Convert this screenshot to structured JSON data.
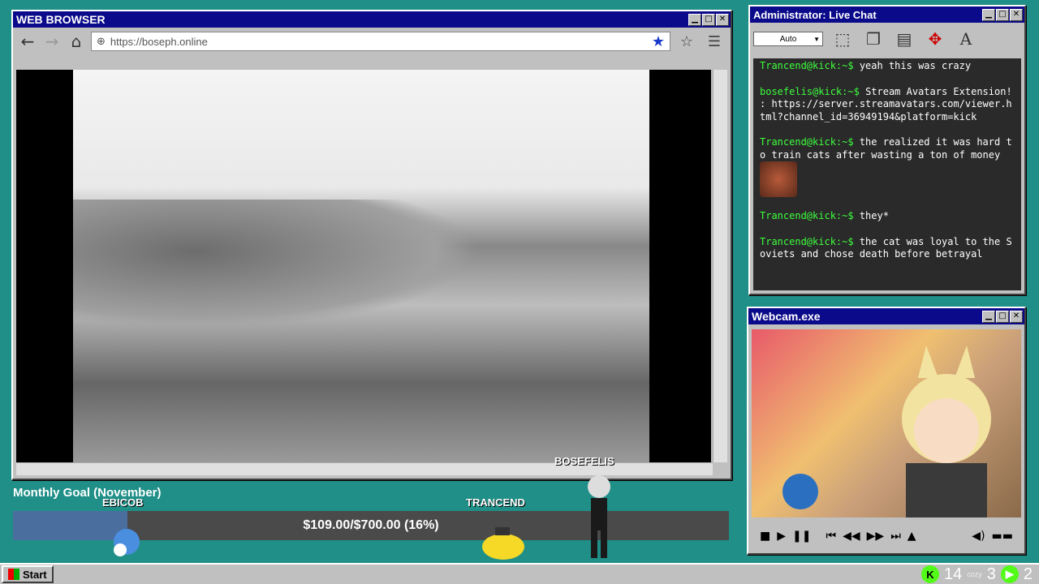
{
  "browser": {
    "title": "WEB BROWSER",
    "url": "https://boseph.online"
  },
  "chat": {
    "title": "Administrator: Live Chat",
    "select_value": "Auto",
    "messages": [
      {
        "user": "Trancend@kick:~$",
        "text": "yeah this was crazy"
      },
      {
        "user": "bosefelis@kick:~$",
        "text": "Stream Avatars Extension! : https://server.streamavatars.com/viewer.html?channel_id=36949194&platform=kick"
      },
      {
        "user": "Trancend@kick:~$",
        "text": "the realized it was hard to train cats after wasting a ton of money"
      },
      {
        "user": "Trancend@kick:~$",
        "text": "they*"
      },
      {
        "user": "Trancend@kick:~$",
        "text": "the cat was loyal to the Soviets and chose death before betrayal"
      }
    ]
  },
  "webcam": {
    "title": "Webcam.exe"
  },
  "goal": {
    "title": "Monthly Goal (November)",
    "text": "$109.00/$700.00 (16%)",
    "progress": 0.16
  },
  "avatars": {
    "ebicob": "EBICOB",
    "trancend": "TRANCEND",
    "bosefelis": "BOSEFELIS"
  },
  "taskbar": {
    "start_label": "Start",
    "count_kick": "14",
    "count_3": "3",
    "count_2": "2",
    "cozy_label": "cozy"
  },
  "colors": {
    "desktop": "#1f8f87",
    "titlebar": "#0a0a8a",
    "chat_user": "#3dff3d",
    "goal_fill": "#4a6f9f"
  }
}
